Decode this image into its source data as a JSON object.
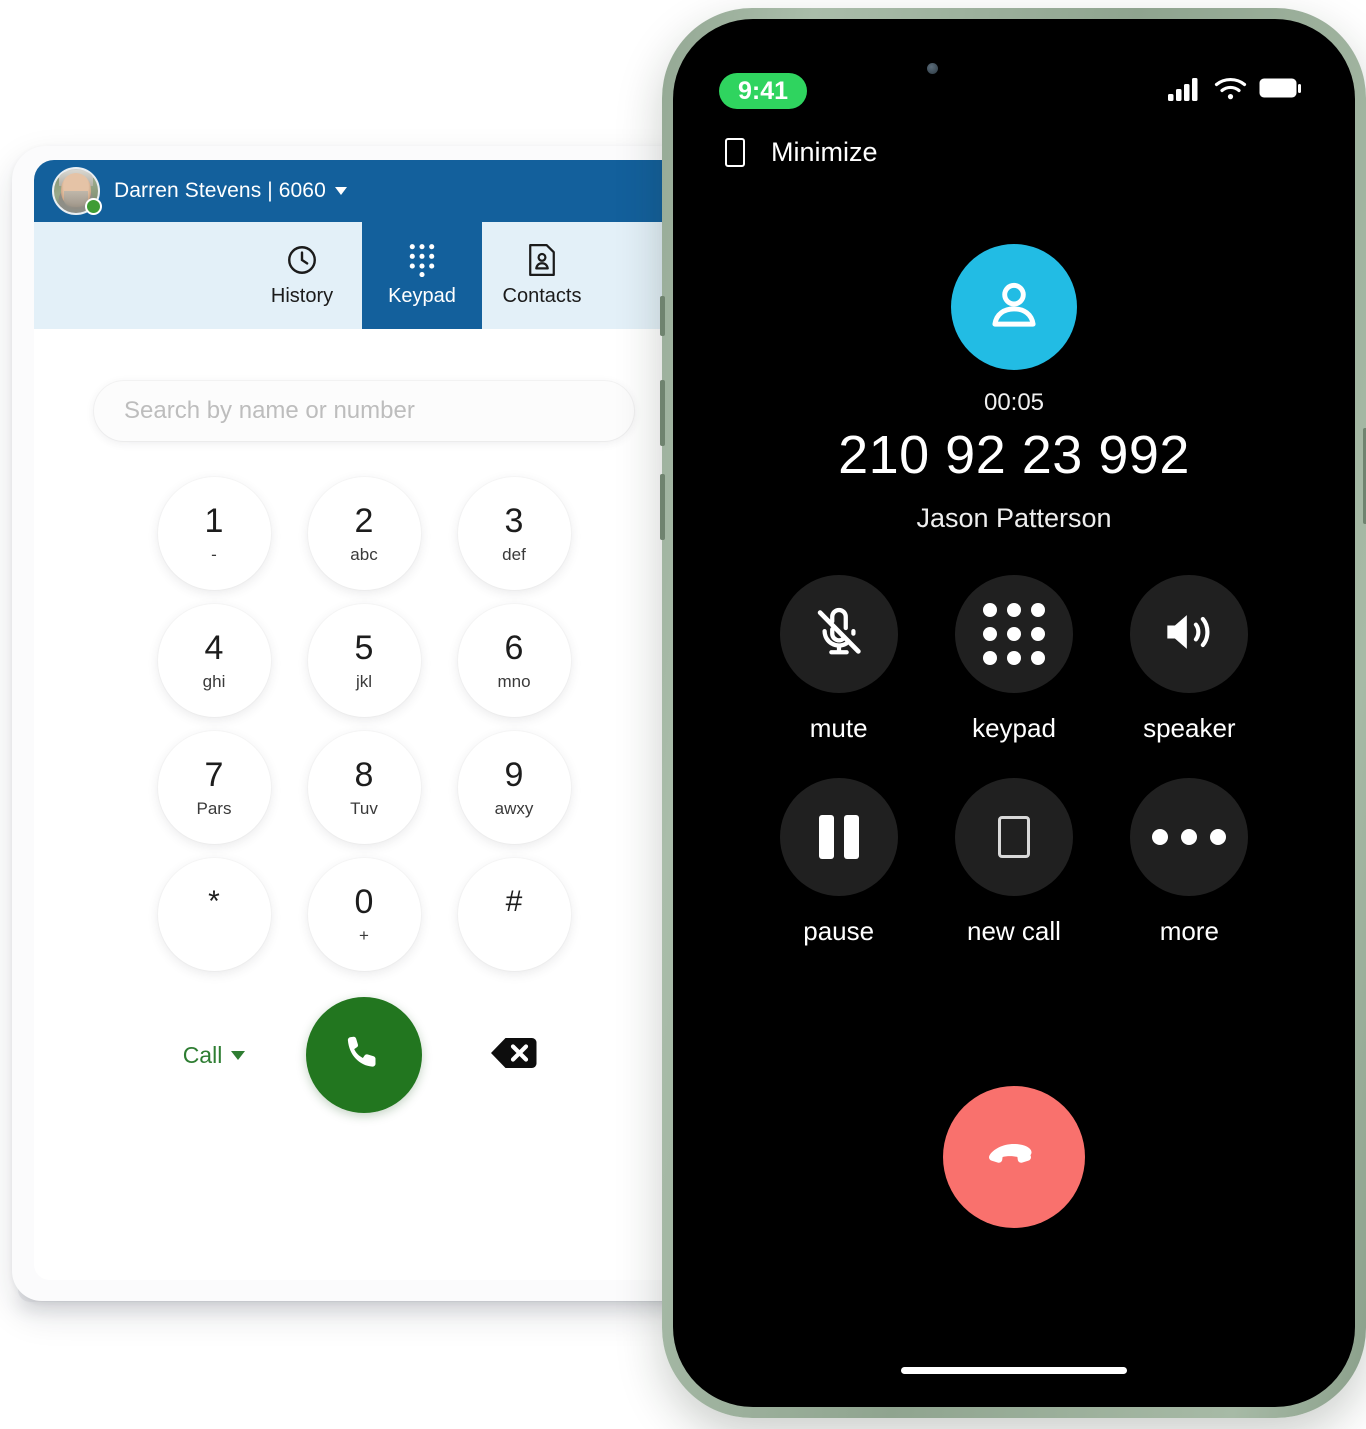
{
  "desktop": {
    "header": {
      "user_label": "Darren Stevens | 6060",
      "presence": "online",
      "caret": "chevron-down",
      "bg_color": "#13609c"
    },
    "tabs": [
      {
        "label": "History",
        "icon": "clock-icon",
        "active": false
      },
      {
        "label": "Keypad",
        "icon": "dialpad-icon",
        "active": true
      },
      {
        "label": "Contacts",
        "icon": "contact-card-icon",
        "active": false
      }
    ],
    "search": {
      "placeholder": "Search by name or number",
      "value": ""
    },
    "keypad": [
      {
        "digit": "1",
        "letters": "-"
      },
      {
        "digit": "2",
        "letters": "abc"
      },
      {
        "digit": "3",
        "letters": "def"
      },
      {
        "digit": "4",
        "letters": "ghi"
      },
      {
        "digit": "5",
        "letters": "jkl"
      },
      {
        "digit": "6",
        "letters": "mno"
      },
      {
        "digit": "7",
        "letters": "Pars"
      },
      {
        "digit": "8",
        "letters": "Tuv"
      },
      {
        "digit": "9",
        "letters": "awxy"
      },
      {
        "digit": "*",
        "letters": ""
      },
      {
        "digit": "0",
        "letters": "+"
      },
      {
        "digit": "#",
        "letters": ""
      }
    ],
    "actions": {
      "call_dropdown_label": "Call",
      "call_button": "call-button",
      "backspace_button": "backspace-button",
      "call_green": "#22761f",
      "dropdown_green": "#2e7d32"
    }
  },
  "phone": {
    "frame_color": "#94a894",
    "status_bar": {
      "time": "9:41",
      "time_pill_color": "#2fd45f",
      "signal": "cellular-signal-icon",
      "wifi": "wifi-icon",
      "battery": "battery-icon"
    },
    "minimize": {
      "label": "Minimize",
      "icon": "minimize-icon"
    },
    "call": {
      "avatar_icon": "person-icon",
      "avatar_color": "#22bce4",
      "duration": "00:05",
      "number": "210 92 23 992",
      "name": "Jason Patterson"
    },
    "controls": [
      {
        "label": "mute",
        "icon": "mic-off-icon"
      },
      {
        "label": "keypad",
        "icon": "dialpad-icon"
      },
      {
        "label": "speaker",
        "icon": "speaker-icon"
      },
      {
        "label": "pause",
        "icon": "pause-icon"
      },
      {
        "label": "new call",
        "icon": "new-call-icon"
      },
      {
        "label": "more",
        "icon": "ellipsis-icon"
      }
    ],
    "end_call": {
      "icon": "end-call-icon",
      "color": "#f9716d"
    }
  }
}
